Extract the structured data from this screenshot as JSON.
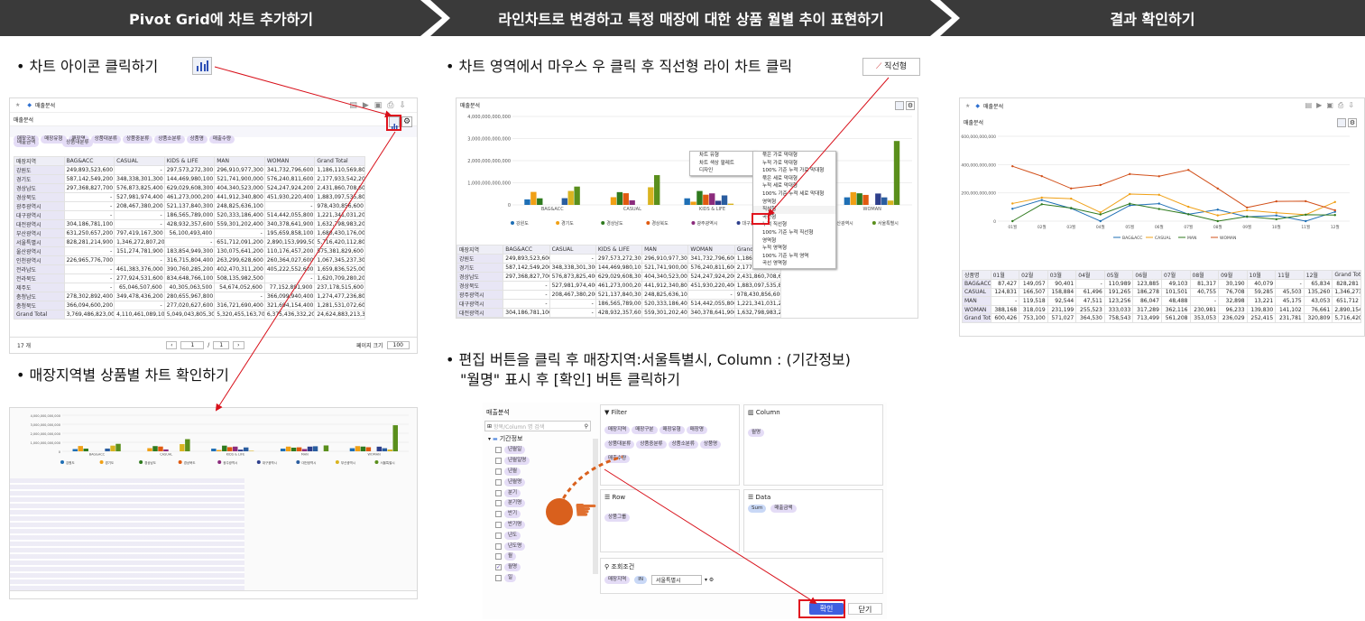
{
  "steps": [
    "Pivot Grid에 차트 추가하기",
    "라인차트로 변경하고 특정 매장에 대한 상품 월별 추이 표현하기",
    "결과 확인하기"
  ],
  "bullets": {
    "b1": "• 차트 아이콘 클릭하기",
    "b2": "• 매장지역별 상품별 차트 확인하기",
    "b3": "• 차트 영역에서 마우스 우 클릭 후 직선형 라이 차트 클릭",
    "b3_badge": "직선형",
    "b4a": "• 편집 버튼을 클릭 후 매장지역:서울특별시, Column : (기간정보)",
    "b4b": "\"월명\" 표시 후 [확인] 버튼 클릭하기"
  },
  "panel1": {
    "title": "매출분석",
    "subtitle": "매출분석",
    "filters": [
      "매장구분",
      "매장유형",
      "매장명",
      "상품대분류",
      "상품중분류",
      "상품소분류",
      "상품명",
      "매출수량"
    ],
    "value_chip": "매출금액",
    "col_chip": "상품대분류",
    "headers": [
      "매장지역",
      "BAG&ACC",
      "CASUAL",
      "KIDS & LIFE",
      "MAN",
      "WOMAN",
      "Grand Total"
    ],
    "rows": [
      [
        "강원도",
        "249,893,523,600",
        "-",
        "297,573,272,300",
        "296,910,977,300",
        "341,732,796,600",
        "1,186,110,569,800"
      ],
      [
        "경기도",
        "587,142,549,200",
        "348,338,301,300",
        "144,469,980,100",
        "521,741,900,000",
        "576,240,811,600",
        "2,177,933,542,200"
      ],
      [
        "경상남도",
        "297,368,827,700",
        "576,873,825,400",
        "629,029,608,300",
        "404,340,523,000",
        "524,247,924,200",
        "2,431,860,708,600"
      ],
      [
        "경상북도",
        "-",
        "527,981,974,400",
        "461,273,000,200",
        "441,912,340,800",
        "451,930,220,400",
        "1,883,097,535,800"
      ],
      [
        "광주광역시",
        "-",
        "208,467,380,200",
        "521,137,840,300",
        "248,825,636,100",
        "-",
        "978,430,856,600"
      ],
      [
        "대구광역시",
        "-",
        "-",
        "186,565,789,000",
        "520,333,186,400",
        "514,442,055,800",
        "1,221,341,031,200"
      ],
      [
        "대전광역시",
        "304,186,781,100",
        "-",
        "428,932,357,600",
        "559,301,202,400",
        "340,378,641,900",
        "1,632,798,983,200"
      ],
      [
        "부산광역시",
        "631,250,657,200",
        "797,419,167,300",
        "56,100,493,400",
        "-",
        "195,659,858,100",
        "1,680,430,176,000"
      ],
      [
        "서울특별시",
        "828,281,214,900",
        "1,346,272,807,200",
        "-",
        "651,712,091,200",
        "2,890,153,999,500",
        "5,716,420,112,800"
      ],
      [
        "울산광역시",
        "-",
        "151,274,781,900",
        "183,854,949,300",
        "130,075,641,200",
        "110,176,457,200",
        "575,381,829,600"
      ],
      [
        "인천광역시",
        "226,965,776,700",
        "-",
        "316,715,804,400",
        "263,299,628,600",
        "260,364,027,600",
        "1,067,345,237,300"
      ],
      [
        "전라남도",
        "-",
        "461,383,376,000",
        "390,760,285,200",
        "402,470,311,200",
        "405,222,552,600",
        "1,659,836,525,000"
      ],
      [
        "전라북도",
        "-",
        "277,924,531,600",
        "834,648,766,100",
        "508,135,982,500",
        "-",
        "1,620,709,280,200"
      ],
      [
        "제주도",
        "-",
        "65,046,507,600",
        "40,305,063,500",
        "54,674,052,600",
        "77,152,891,900",
        "237,178,515,600"
      ],
      [
        "충청남도",
        "278,302,892,400",
        "349,478,436,200",
        "280,655,967,800",
        "-",
        "366,099,940,400",
        "1,274,477,236,800"
      ],
      [
        "충청북도",
        "366,094,600,200",
        "-",
        "277,020,627,600",
        "316,721,690,400",
        "321,694,154,400",
        "1,281,531,072,600"
      ],
      [
        "Grand Total",
        "3,769,486,823,000",
        "4,110,461,089,100",
        "5,049,043,805,300",
        "5,320,455,163,700",
        "6,375,436,332,200",
        "24,624,883,213,300"
      ]
    ],
    "footer_count": "17 개",
    "pager": "1",
    "pager_total": "1",
    "page_size_label": "페이지 크기",
    "page_size": "100"
  },
  "chart_data": {
    "type": "bar",
    "categories": [
      "BAG&ACC",
      "CASUAL",
      "KIDS & LIFE",
      "MAN",
      "WOMAN"
    ],
    "yticks": [
      "4,000,000,000,000",
      "3,000,000,000,000",
      "2,000,000,000,000",
      "1,000,000,000,000",
      "0"
    ],
    "ylim": [
      0,
      4000000000000
    ],
    "series": [
      {
        "name": "강원도",
        "color": "#1f6fb5",
        "values": [
          249893523600,
          0,
          297573272300,
          296910977300,
          341732796600
        ]
      },
      {
        "name": "경기도",
        "color": "#f0a015",
        "values": [
          587142549200,
          348338301300,
          144469980100,
          521741900000,
          576240811600
        ]
      },
      {
        "name": "경상남도",
        "color": "#2f7a1e",
        "values": [
          297368827700,
          576873825400,
          629029608300,
          404340523000,
          524247924200
        ]
      },
      {
        "name": "경상북도",
        "color": "#e05a10",
        "values": [
          0,
          527981974400,
          461273000200,
          441912340800,
          451930220400
        ]
      },
      {
        "name": "광주광역시",
        "color": "#8b2b7c",
        "values": [
          0,
          208467380200,
          521137840300,
          248825636100,
          0
        ]
      },
      {
        "name": "대구광역시",
        "color": "#2e3f8c",
        "values": [
          0,
          0,
          186565789000,
          520333186400,
          514442055800
        ]
      },
      {
        "name": "대전광역시",
        "color": "#2a5d9f",
        "values": [
          304186781100,
          0,
          428932357600,
          559301202400,
          340378641900
        ]
      },
      {
        "name": "부산광역시",
        "color": "#d9b420",
        "values": [
          631250657200,
          797419167300,
          56100493400,
          0,
          195659858100
        ]
      },
      {
        "name": "서울특별시",
        "color": "#5a8f1c",
        "values": [
          828281214900,
          1346272807200,
          0,
          651712091200,
          2890153999500
        ]
      }
    ]
  },
  "context_menu": {
    "main": [
      "차트 유형",
      "차트 색상 팔레트",
      "디자인"
    ],
    "sub": [
      "묶은 가로 막대형",
      "누적 가로 막대형",
      "100% 기준 누적 가로 막대형",
      "묶은 세로 막대형",
      "누적 세로 막대형",
      "100% 기준 누적 세로 막대형",
      "영역형",
      "직선형",
      "곡선형",
      "누적 직선형",
      "100% 기준 누적 직선형",
      "영역형",
      "누적 영역형",
      "100% 기준 누적 영역",
      "곡선 영역형"
    ]
  },
  "editor": {
    "title": "매출분석",
    "search_placeholder": "항목/Column 명 검색",
    "tree_root": "기간정보",
    "tree_items": [
      "년월일",
      "년월일명",
      "년월",
      "년월명",
      "분기",
      "분기명",
      "반기",
      "반기명",
      "년도",
      "년도명",
      "월",
      "월명",
      "일"
    ],
    "checked_index": 11,
    "filter_title": "Filter",
    "filter_chips": [
      "매장지역",
      "매장구분",
      "매장유형",
      "매장명",
      "상품대분류",
      "상품중분류",
      "상품소분류",
      "상품명",
      "매출수량"
    ],
    "column_title": "Column",
    "column_chips": [
      "월명"
    ],
    "row_title": "Row",
    "row_chips": [
      "상품그룹"
    ],
    "data_title": "Data",
    "data_agg": "Sum",
    "data_chips": [
      "매출금액"
    ],
    "cond_title": "조회조건",
    "cond_field": "매장지역",
    "cond_op": "IN",
    "cond_value": "서울특별시",
    "ok": "확인",
    "cancel": "닫기"
  },
  "result": {
    "title": "매출분석",
    "line_chart": {
      "type": "line",
      "months": [
        "01월",
        "02월",
        "03월",
        "04월",
        "05월",
        "06월",
        "07월",
        "08월",
        "09월",
        "10월",
        "11월",
        "12월"
      ],
      "yticks": [
        "600,000,000,000",
        "400,000,000,000",
        "200,000,000,000",
        "0"
      ],
      "series": [
        {
          "name": "BAG&ACC",
          "color": "#1f6fb5",
          "values": [
            87427,
            149057,
            90401,
            0,
            110989,
            123885,
            49103,
            81317,
            30190,
            40079,
            0,
            65834
          ]
        },
        {
          "name": "CASUAL",
          "color": "#f0a015",
          "values": [
            124831,
            166507,
            158884,
            61496,
            191265,
            186278,
            101501,
            40755,
            76708,
            59285,
            45503,
            135260
          ]
        },
        {
          "name": "MAN",
          "color": "#2f7a1e",
          "values": [
            0,
            119518,
            92544,
            47511,
            123256,
            86047,
            48488,
            0,
            32898,
            13221,
            45175,
            43053
          ]
        },
        {
          "name": "WOMAN",
          "color": "#d2501a",
          "values": [
            388168,
            318019,
            231199,
            255523,
            333033,
            317289,
            362116,
            230981,
            96233,
            139830,
            141102,
            76661
          ]
        }
      ]
    },
    "grid_headers": [
      "상품명",
      "01월",
      "02월",
      "03월",
      "04월",
      "05월",
      "06월",
      "07월",
      "08월",
      "09월",
      "10월",
      "11월",
      "12월",
      "Grand Total"
    ],
    "grid_rows": [
      [
        "BAG&ACC",
        "87,427",
        "149,057",
        "90,401",
        "-",
        "110,989",
        "123,885",
        "49,103",
        "81,317",
        "30,190",
        "40,079",
        "-",
        "65,834",
        "828,281"
      ],
      [
        "CASUAL",
        "124,831",
        "166,507",
        "158,884",
        "61,496",
        "191,265",
        "186,278",
        "101,501",
        "40,755",
        "76,708",
        "59,285",
        "45,503",
        "135,260",
        "1,346,273"
      ],
      [
        "MAN",
        "-",
        "119,518",
        "92,544",
        "47,511",
        "123,256",
        "86,047",
        "48,488",
        "-",
        "32,898",
        "13,221",
        "45,175",
        "43,053",
        "651,712"
      ],
      [
        "WOMAN",
        "388,168",
        "318,019",
        "231,199",
        "255,523",
        "333,033",
        "317,289",
        "362,116",
        "230,981",
        "96,233",
        "139,830",
        "141,102",
        "76,661",
        "2,890,154"
      ],
      [
        "Grand Total",
        "600,426",
        "753,100",
        "571,027",
        "364,530",
        "758,543",
        "713,499",
        "561,208",
        "353,053",
        "236,029",
        "252,415",
        "231,781",
        "320,809",
        "5,716,420"
      ]
    ]
  }
}
